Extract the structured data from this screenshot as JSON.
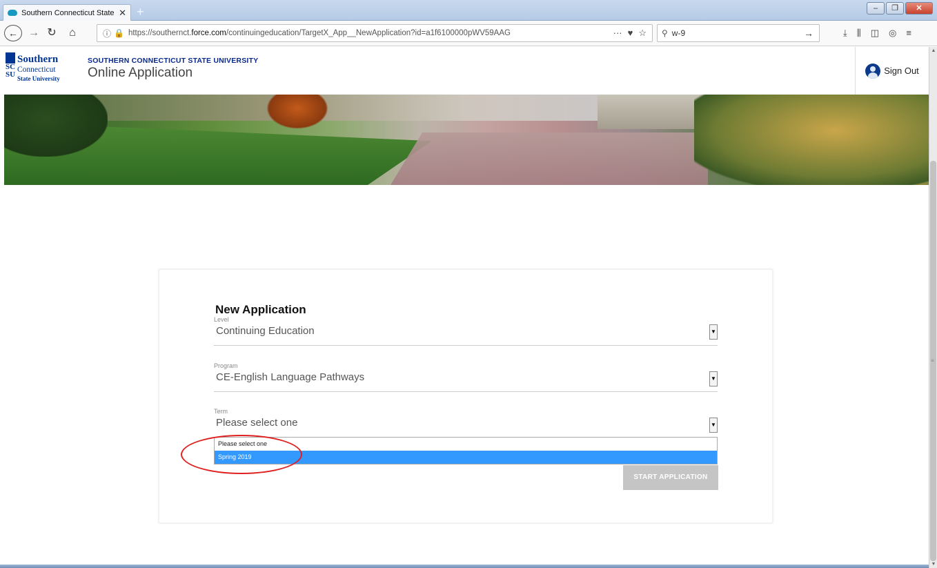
{
  "browser": {
    "tab_title": "Southern Connecticut State Uni",
    "url_prefix": "https://southernct.",
    "url_domain": "force.com",
    "url_path": "/continuingeducation/TargetX_App__NewApplication?id=a1f6100000pWV59AAG",
    "search_query": "w-9"
  },
  "header": {
    "logo": {
      "line1": "Southern",
      "line2": "Connecticut",
      "line3": "State University",
      "sc": "SC",
      "su": "SU"
    },
    "university": "SOUTHERN CONNECTICUT STATE UNIVERSITY",
    "app_title": "Online Application",
    "sign_out": "Sign Out"
  },
  "form": {
    "title": "New Application",
    "level": {
      "label": "Level",
      "value": "Continuing Education"
    },
    "program": {
      "label": "Program",
      "value": "CE-English Language Pathways"
    },
    "term": {
      "label": "Term",
      "value": "Please select one",
      "options": [
        "Please select one",
        "Spring 2019"
      ],
      "highlighted_option": "Spring 2019"
    },
    "start_button": "START APPLICATION"
  },
  "colors": {
    "brand_blue": "#003594",
    "dropdown_highlight": "#3399ff",
    "annotation_red": "#e02020",
    "button_disabled": "#c5c5c5"
  }
}
